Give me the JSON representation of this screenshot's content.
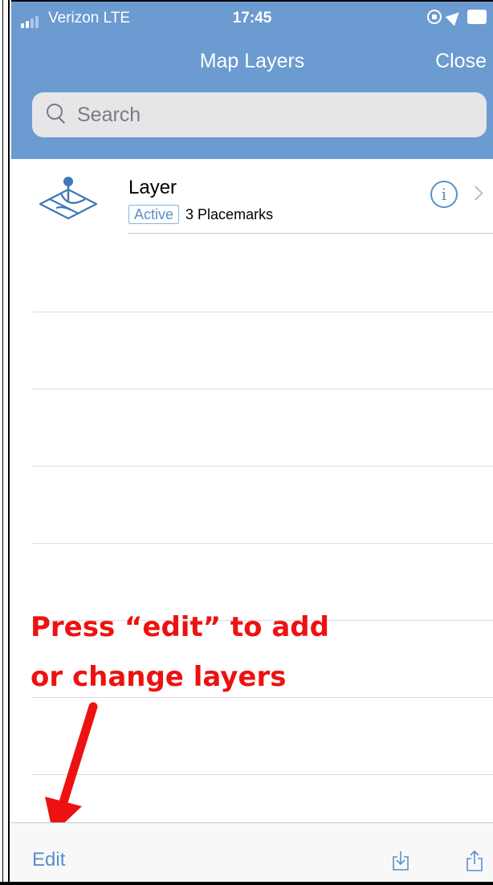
{
  "status_bar": {
    "carrier": "Verizon  LTE",
    "time": "17:45"
  },
  "nav": {
    "title": "Map Layers",
    "close_label": "Close"
  },
  "search": {
    "placeholder": "Search"
  },
  "layers": [
    {
      "name": "Layer",
      "status": "Active",
      "placemarks": "3 Placemarks"
    }
  ],
  "annotation": {
    "line1": "Press “edit” to add",
    "line2": "or change layers"
  },
  "toolbar": {
    "edit_label": "Edit",
    "icons": [
      "import-icon",
      "share-icon"
    ]
  },
  "colors": {
    "header": "#6b9bd0",
    "accent": "#5b8fc9",
    "annotation": "#ee1111"
  }
}
